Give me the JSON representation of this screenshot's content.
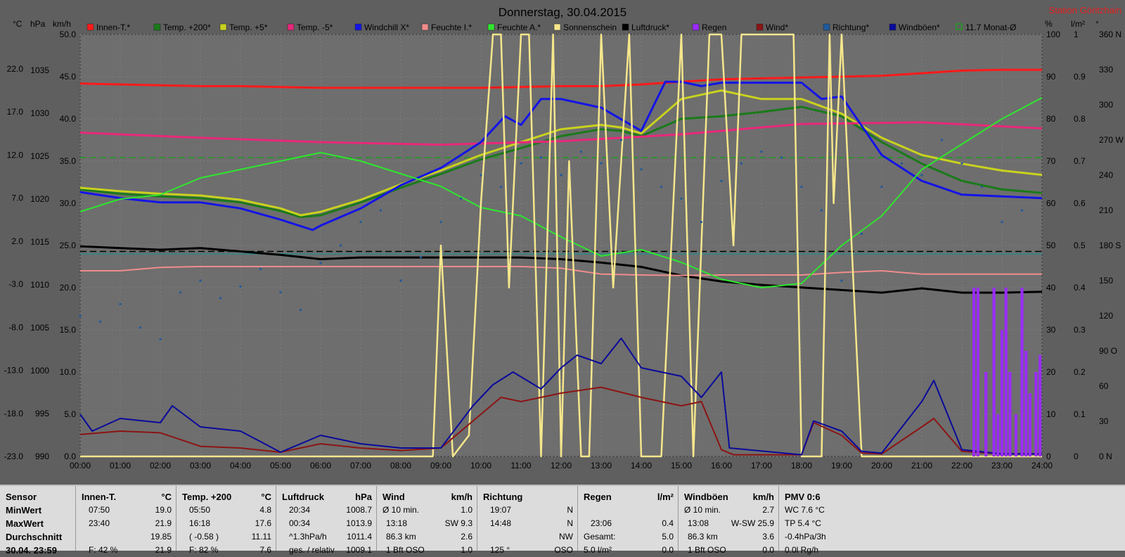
{
  "chart_data": {
    "type": "line",
    "title": "Donnerstag, 30.04.2015",
    "station": "Station Göritzhain",
    "x_ticks": [
      "00:00",
      "01:00",
      "02:00",
      "03:00",
      "04:00",
      "05:00",
      "06:00",
      "07:00",
      "08:00",
      "09:00",
      "10:00",
      "11:00",
      "12:00",
      "13:00",
      "14:00",
      "15:00",
      "16:00",
      "17:00",
      "18:00",
      "19:00",
      "20:00",
      "21:00",
      "22:00",
      "23:00",
      "24:00"
    ],
    "left_axes": {
      "celsius": {
        "unit": "°C",
        "ticks": [
          "22.0",
          "17.0",
          "12.0",
          "7.0",
          "2.0",
          "-3.0",
          "-8.0",
          "-13.0",
          "-18.0",
          "-23.0"
        ]
      },
      "hpa": {
        "unit": "hPa",
        "ticks": [
          "1035",
          "1030",
          "1025",
          "1020",
          "1015",
          "1010",
          "1005",
          "1000",
          "995",
          "990"
        ]
      },
      "kmh": {
        "unit": "km/h",
        "ticks": [
          "50.0",
          "45.0",
          "40.0",
          "35.0",
          "30.0",
          "25.0",
          "20.0",
          "15.0",
          "10.0",
          "5.0",
          "0.0"
        ]
      }
    },
    "right_axes": {
      "percent": {
        "unit": "%",
        "ticks": [
          "100",
          "90",
          "80",
          "70",
          "60",
          "50",
          "40",
          "30",
          "20",
          "10",
          "0"
        ]
      },
      "lm2": {
        "unit": "l/m²",
        "ticks": [
          "1",
          "0.9",
          "0.8",
          "0.7",
          "0.6",
          "0.5",
          "0.4",
          "0.3",
          "0.2",
          "0.1",
          "0"
        ]
      },
      "deg": {
        "unit": "°",
        "ticks": [
          "360 N",
          "330",
          "300",
          "270 W",
          "240",
          "210",
          "180 S",
          "150",
          "120",
          "90 O",
          "60",
          "30",
          "0 N"
        ]
      }
    },
    "legend": [
      {
        "name": "Innen-T.*",
        "color": "#ff1a1a"
      },
      {
        "name": "Temp. +200*",
        "color": "#1a7a1a"
      },
      {
        "name": "Temp. +5*",
        "color": "#c8d21e"
      },
      {
        "name": "Temp. -5*",
        "color": "#e8287a"
      },
      {
        "name": "Windchill X*",
        "color": "#1414e6"
      },
      {
        "name": "Feuchte I.*",
        "color": "#f08c8c"
      },
      {
        "name": "Feuchte A.*",
        "color": "#2ee62e"
      },
      {
        "name": "Sonnenschein",
        "color": "#f5e68c"
      },
      {
        "name": "Luftdruck*",
        "color": "#000000"
      },
      {
        "name": "Regen",
        "color": "#9b2bff"
      },
      {
        "name": "Wind*",
        "color": "#8c1414"
      },
      {
        "name": "Richtung*",
        "color": "#1e5a9b"
      },
      {
        "name": "Windböen*",
        "color": "#0a0a9b"
      },
      {
        "name": "11.7 Monat-Ø",
        "color": "#1e9b1e"
      }
    ],
    "series": [
      {
        "name": "Innen-T.*",
        "axis": "celsius",
        "color": "#ff1a1a",
        "x": [
          0,
          1,
          2,
          3,
          4,
          5,
          6,
          7,
          8,
          9,
          10,
          11,
          12,
          13,
          14,
          15,
          16,
          17,
          18,
          19,
          20,
          21,
          22,
          23,
          24
        ],
        "y": [
          20.3,
          20.2,
          20.1,
          20.0,
          20.0,
          19.9,
          19.8,
          19.8,
          19.8,
          19.8,
          19.8,
          19.9,
          20.0,
          20.0,
          20.2,
          20.5,
          20.8,
          20.9,
          21.0,
          21.1,
          21.2,
          21.5,
          21.8,
          21.9,
          21.9
        ]
      },
      {
        "name": "Temp. +200*",
        "axis": "celsius",
        "color": "#1a7a1a",
        "x": [
          0,
          1,
          2,
          3,
          4,
          5,
          5.5,
          6,
          7,
          8,
          9,
          10,
          11,
          12,
          13,
          13.5,
          14,
          15,
          16,
          17,
          18,
          19,
          20,
          21,
          22,
          23,
          24
        ],
        "y": [
          8.0,
          7.5,
          7.2,
          7.0,
          6.5,
          5.5,
          4.8,
          5.0,
          6.5,
          8.2,
          9.8,
          11.5,
          12.8,
          14.2,
          15.0,
          14.8,
          14.2,
          16.2,
          16.5,
          17.0,
          17.6,
          16.5,
          13.5,
          11.0,
          9.0,
          8.0,
          7.6
        ]
      },
      {
        "name": "Temp. +5*",
        "axis": "celsius",
        "color": "#c8d21e",
        "x": [
          0,
          1,
          2,
          3,
          4,
          5,
          5.5,
          6,
          7,
          8,
          9,
          10,
          11,
          12,
          13,
          13.5,
          14,
          15,
          16,
          17,
          18,
          19,
          20,
          21,
          22,
          23,
          24
        ],
        "y": [
          8.2,
          7.8,
          7.5,
          7.3,
          6.8,
          5.8,
          5.0,
          5.4,
          6.8,
          8.6,
          10.2,
          12.0,
          13.5,
          15.0,
          15.5,
          15.2,
          14.5,
          18.5,
          19.5,
          18.5,
          18.5,
          16.8,
          14.0,
          12.0,
          11.0,
          10.2,
          9.7
        ]
      },
      {
        "name": "Temp. -5*",
        "axis": "celsius",
        "color": "#e8287a",
        "x": [
          0,
          3,
          6,
          9,
          12,
          15,
          18,
          21,
          24
        ],
        "y": [
          14.6,
          14.0,
          13.5,
          13.2,
          13.6,
          14.4,
          15.6,
          15.8,
          15.1
        ]
      },
      {
        "name": "Windchill X*",
        "axis": "celsius",
        "color": "#1414e6",
        "x": [
          0,
          1,
          2,
          3,
          4,
          5,
          5.8,
          6,
          7,
          8,
          9,
          10,
          10.6,
          11,
          11.5,
          12,
          13,
          14,
          14.6,
          15,
          15.5,
          16,
          17,
          18,
          18.5,
          19,
          20,
          21,
          22,
          23,
          24
        ],
        "y": [
          7.7,
          7.0,
          6.5,
          6.5,
          5.8,
          4.5,
          3.3,
          3.8,
          5.8,
          8.5,
          10.5,
          13.5,
          16.5,
          15.5,
          18.5,
          18.5,
          17.5,
          14.8,
          20.5,
          20.5,
          20.0,
          20.4,
          20.4,
          20.4,
          18.5,
          18.8,
          12.0,
          9.0,
          7.4,
          7.2,
          7.0
        ]
      },
      {
        "name": "Luftdruck*",
        "axis": "hpa",
        "color": "#000000",
        "x": [
          0,
          1,
          2,
          3,
          4,
          5,
          6,
          7,
          8,
          9,
          10,
          11,
          12,
          13,
          14,
          15,
          16,
          17,
          18,
          19,
          20,
          21,
          22,
          23,
          24
        ],
        "y": [
          1014.5,
          1014.3,
          1014.1,
          1014.3,
          1013.9,
          1013.5,
          1013.0,
          1013.2,
          1013.2,
          1013.2,
          1013.2,
          1013.2,
          1013.0,
          1012.6,
          1012.1,
          1011.1,
          1010.4,
          1010.0,
          1009.7,
          1009.4,
          1009.1,
          1009.6,
          1009.1,
          1009.1,
          1009.2
        ]
      },
      {
        "name": "Feuchte I.*",
        "axis": "percent",
        "color": "#f08c8c",
        "x": [
          0,
          1,
          2,
          3,
          4,
          5,
          6,
          7,
          8,
          9,
          10,
          11,
          12,
          13,
          14,
          15,
          16,
          17,
          18,
          19,
          20,
          21,
          22,
          23,
          24
        ],
        "y": [
          44.0,
          44.0,
          44.8,
          45.0,
          45.0,
          45.0,
          45.0,
          45.0,
          45.0,
          45.0,
          45.0,
          45.0,
          44.6,
          43.2,
          43.0,
          42.9,
          43.0,
          43.0,
          43.0,
          43.6,
          44.0,
          43.2,
          43.2,
          43.2,
          43.2
        ]
      },
      {
        "name": "Feuchte A.*",
        "axis": "percent",
        "color": "#2ee62e",
        "x": [
          0,
          1,
          2,
          3,
          4,
          5,
          6,
          7,
          8,
          9,
          10,
          11,
          12,
          13,
          14,
          15,
          16,
          17,
          18,
          19,
          20,
          21,
          22,
          23,
          24
        ],
        "y": [
          58.0,
          61.0,
          62.0,
          66.0,
          68.0,
          70.0,
          72.0,
          70.0,
          67.0,
          64.0,
          59.0,
          57.0,
          52.0,
          47.5,
          49.0,
          46.0,
          42.0,
          40.0,
          41.0,
          50.0,
          57.0,
          68.0,
          74.0,
          80.0,
          85.0
        ]
      },
      {
        "name": "Sonnenschein",
        "axis": "percent",
        "color": "#f5e68c",
        "x": [
          0,
          8.8,
          9.0,
          9.3,
          9.7,
          10.0,
          10.3,
          10.5,
          10.7,
          11.0,
          11.2,
          11.5,
          11.8,
          12.0,
          12.2,
          12.5,
          12.7,
          13.0,
          13.3,
          13.7,
          14.0,
          14.5,
          15.0,
          15.3,
          15.7,
          16.0,
          16.3,
          16.5,
          16.8,
          17.0,
          17.5,
          17.8,
          18.0,
          18.5,
          18.7,
          18.8,
          19.0,
          19.5,
          19.8,
          24
        ],
        "y": [
          0,
          0,
          50,
          0,
          5,
          60,
          100,
          100,
          40,
          100,
          100,
          0,
          100,
          0,
          70,
          0,
          0,
          100,
          40,
          100,
          0,
          0,
          100,
          0,
          100,
          100,
          50,
          100,
          100,
          100,
          100,
          100,
          0,
          0,
          100,
          60,
          100,
          0,
          0,
          0
        ]
      },
      {
        "name": "Wind*",
        "axis": "kmh",
        "color": "#8c1414",
        "x": [
          0,
          1,
          2,
          3,
          4,
          5,
          6,
          7,
          8,
          9,
          10,
          10.5,
          11,
          12,
          13,
          14,
          15,
          15.5,
          16,
          16.3,
          18.0,
          18.3,
          19.0,
          19.5,
          20,
          21,
          21.3,
          22,
          23,
          24
        ],
        "y": [
          2.6,
          3.0,
          2.8,
          1.2,
          1.0,
          0.5,
          1.5,
          1.0,
          0.7,
          1.0,
          5.0,
          7.0,
          6.5,
          7.5,
          8.2,
          7.0,
          6.0,
          6.5,
          0.8,
          0.2,
          0.2,
          4.0,
          2.5,
          0.4,
          0.3,
          3.5,
          4.5,
          0.6,
          0.3,
          0.3
        ]
      },
      {
        "name": "Windböen*",
        "axis": "kmh",
        "color": "#0a0a9b",
        "x": [
          0,
          0.3,
          1,
          2,
          2.3,
          3,
          4,
          5,
          6,
          7,
          8,
          9,
          9.8,
          10.3,
          10.8,
          11.5,
          12,
          12.4,
          13,
          13.5,
          14,
          15,
          15.5,
          16,
          16.2,
          18.0,
          18.3,
          19.0,
          19.5,
          20,
          21.0,
          21.3,
          22,
          23,
          24
        ],
        "y": [
          5.0,
          3.0,
          4.5,
          4.0,
          6.0,
          3.5,
          3.0,
          0.5,
          2.5,
          1.5,
          1.0,
          1.0,
          6.0,
          8.5,
          10.0,
          8.0,
          10.5,
          12.0,
          11.0,
          14.0,
          10.5,
          9.5,
          7.0,
          10.0,
          1.0,
          0.2,
          4.2,
          3.0,
          0.6,
          0.4,
          6.5,
          9.0,
          0.8,
          0.3,
          0.3
        ]
      },
      {
        "name": "Regen",
        "axis": "lm2",
        "color": "#9b2bff",
        "type": "bar",
        "x": [
          22.3,
          22.4,
          22.6,
          22.8,
          22.9,
          23.0,
          23.1,
          23.2,
          23.35,
          23.5,
          23.6,
          23.7,
          23.85,
          23.95
        ],
        "y": [
          0.4,
          0.4,
          0.2,
          0.4,
          0.1,
          0.3,
          0.4,
          0.2,
          0.1,
          0.4,
          0.25,
          0.15,
          0.2,
          0.24
        ]
      },
      {
        "name": "Richtung*",
        "axis": "deg",
        "color": "#1e5a9b",
        "type": "scatter",
        "x": [
          0,
          0.5,
          1,
          1.5,
          2,
          2.5,
          3,
          3.5,
          4,
          4.5,
          5,
          5.5,
          6,
          6.5,
          7,
          7.5,
          8,
          8.5,
          9,
          9.5,
          10,
          10.5,
          11,
          11.5,
          12,
          12.5,
          13,
          13.5,
          14,
          14.5,
          15,
          15.5,
          16,
          16.5,
          17,
          17.5,
          18,
          18.5,
          19,
          19.5,
          20,
          20.5,
          21,
          21.5,
          22,
          22.5,
          23,
          23.5
        ],
        "y": [
          120,
          115,
          130,
          110,
          100,
          140,
          150,
          135,
          145,
          160,
          140,
          125,
          165,
          180,
          200,
          210,
          150,
          170,
          200,
          220,
          240,
          230,
          250,
          255,
          240,
          260,
          250,
          270,
          245,
          230,
          220,
          200,
          235,
          250,
          260,
          255,
          230,
          210,
          150,
          190,
          230,
          250,
          240,
          270,
          250,
          230,
          200,
          210
        ]
      }
    ],
    "hlines": [
      {
        "name": "11.7 Monat-Ø",
        "axis": "celsius",
        "y": 11.7,
        "color": "#1e9b1e",
        "dashed": true
      },
      {
        "axis": "hpa",
        "y": 1013.9,
        "color": "#000000",
        "dashed": true
      },
      {
        "axis": "percent",
        "y": 48.0,
        "color": "#2a8a8a",
        "dashed": false
      }
    ],
    "ylim_celsius": [
      -23,
      26
    ],
    "ylim_hpa": [
      990,
      1039.2
    ]
  },
  "table": {
    "sensor": {
      "header": "Sensor",
      "rows": [
        "MinWert",
        "MaxWert",
        "Durchschnitt",
        "30.04. 23:59"
      ]
    },
    "innen": {
      "header": "Innen-T.",
      "unit": "°C",
      "rows": [
        [
          "07:50",
          "19.0"
        ],
        [
          "23:40",
          "21.9"
        ],
        [
          "",
          "19.85"
        ],
        [
          "F: 42 %",
          "21.9"
        ]
      ]
    },
    "temp200": {
      "header": "Temp. +200",
      "unit": "°C",
      "rows": [
        [
          "05:50",
          "4.8"
        ],
        [
          "16:18",
          "17.6"
        ],
        [
          "( -0.58 )",
          "11.11"
        ],
        [
          "F: 82 %",
          "7.6"
        ]
      ]
    },
    "luftdruck": {
      "header": "Luftdruck",
      "unit": "hPa",
      "rows": [
        [
          "20:34",
          "1008.7"
        ],
        [
          "00:34",
          "1013.9"
        ],
        [
          "^1.3hPa/h",
          "1011.4"
        ],
        [
          "ges. / relativ",
          "1009.1"
        ]
      ]
    },
    "wind": {
      "header": "Wind",
      "unit": "km/h",
      "rows": [
        [
          "Ø 10 min.",
          "1.0"
        ],
        [
          "13:18",
          "SW 9.3"
        ],
        [
          "86.3 km",
          "2.6"
        ],
        [
          "1 Bft OSO",
          "1.0"
        ]
      ]
    },
    "richtung": {
      "header": "Richtung",
      "unit": "",
      "rows": [
        [
          "19:07",
          "N"
        ],
        [
          "14:48",
          "N"
        ],
        [
          "",
          "NW"
        ],
        [
          "125 °",
          "OSO"
        ]
      ]
    },
    "regen": {
      "header": "Regen",
      "unit": "l/m²",
      "rows": [
        [
          "",
          ""
        ],
        [
          "23:06",
          "0.4"
        ],
        [
          "Gesamt:",
          "5.0"
        ],
        [
          "5.0 l/m²",
          "0.0"
        ]
      ]
    },
    "boeen": {
      "header": "Windböen",
      "unit": "km/h",
      "rows": [
        [
          "Ø 10 min.",
          "2.7"
        ],
        [
          "13:08",
          "W-SW 25.9"
        ],
        [
          "86.3 km",
          "3.6"
        ],
        [
          "1 Bft OSO",
          "0.0"
        ]
      ]
    },
    "pmv": {
      "header": "PMV 0:6",
      "unit": "",
      "rows": [
        "WC 7.6 °C",
        "TP 5.4 °C",
        "-0.4hPa/3h",
        "0.0l Rg/h"
      ]
    }
  }
}
